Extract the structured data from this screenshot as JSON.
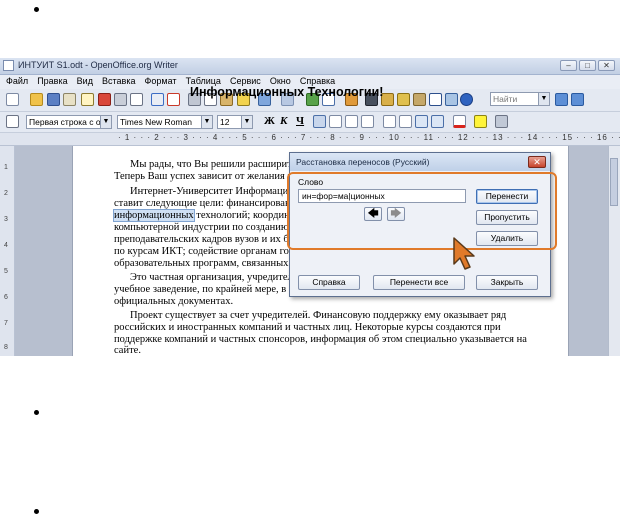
{
  "window": {
    "title": "ИНТУИТ S1.odt - OpenOffice.org Writer",
    "min_glyph": "–",
    "max_glyph": "□",
    "close_glyph": "✕"
  },
  "menu": [
    "Файл",
    "Правка",
    "Вид",
    "Вставка",
    "Формат",
    "Таблица",
    "Сервис",
    "Окно",
    "Справка"
  ],
  "toolbar": {
    "find_placeholder": "Найти"
  },
  "format_bar": {
    "paragraph_style": "Первая строка с отсту",
    "font_name": "Times New Roman",
    "font_size": "12",
    "bold": "Ж",
    "italic": "К",
    "underline": "Ч"
  },
  "ruler": {
    "marks": "· 1 · · · 2 · · · 3 · · · 4 · · · 5 · · · 6 · · · 7 · · · 8 · · · 9 · · · 10 · · · 11 · · · 12 · · · 13 · · · 14 · · · 15 · · · 16 · · 17 · · · 18",
    "vertical_marks": [
      "1",
      "2",
      "3",
      "4",
      "5",
      "6",
      "7",
      "8"
    ]
  },
  "document": {
    "heading": "Информационных Технологии!",
    "lines": [
      "Мы рады, что Вы решили расширить с",
      "Теперь Ваш успех зависит от желания и",
      "Интернет-Университет Информацион",
      "ставит следующие цели: финансирование",
      "технологий; координац",
      "компьютерной индустрии по созданию уч",
      "преподавательских кадров вузов и их бес",
      "по курсам ИКТ; содействие органам госу",
      "образовательных программ, связанных с",
      "Это частная организация, учредителям",
      "учебное заведение, по крайней мере, в то",
      "официальных документах.",
      "Проект существует за счет учредителей. Финансовую поддержку ему оказывает ряд",
      "российских и иностранных компаний и частных лиц. Некоторые курсы создаются при",
      "поддержке компаний и частных спонсоров, информация об этом специально указывается на",
      "сайте."
    ],
    "highlighted_word": "информационных"
  },
  "dialog": {
    "title": "Расстановка переносов (Русский)",
    "word_label": "Слово",
    "word_value": "ин=фор=ма|ционных",
    "buttons": {
      "hyphenate": "Перенести",
      "skip": "Пропустить",
      "remove": "Удалить",
      "help": "Справка",
      "hyphenate_all": "Перенести все",
      "close": "Закрыть"
    },
    "arrow_left": "🡄",
    "arrow_right": "🡆"
  },
  "colors": {
    "annotation_frame": "#e07a2a",
    "cursor_fill": "#e07a2a"
  }
}
